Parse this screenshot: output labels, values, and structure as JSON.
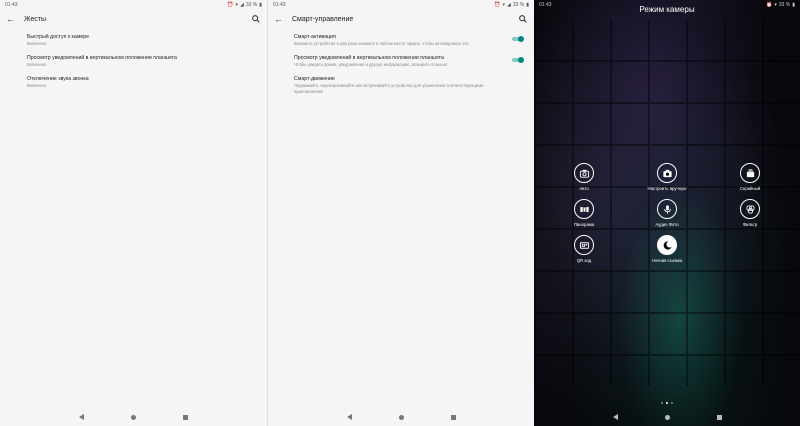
{
  "panel1": {
    "status": {
      "time": "01:43",
      "battery": "33 %"
    },
    "title": "Жесты",
    "items": [
      {
        "title": "Быстрый доступ к камере",
        "subtitle": "Включено"
      },
      {
        "title": "Просмотр уведомлений в вертикальном положении планшета",
        "subtitle": "Включено"
      },
      {
        "title": "Отключение звука звонка",
        "subtitle": "Включено"
      }
    ]
  },
  "panel2": {
    "status": {
      "time": "01:43",
      "battery": "33 %"
    },
    "title": "Смарт-управление",
    "items": [
      {
        "title": "Смарт-активация",
        "subtitle": "Возьмите устройство и два раза нажмите в любом месте экрана, чтобы активировать его",
        "toggle": true
      },
      {
        "title": "Просмотр уведомлений в вертикальном положении планшета",
        "subtitle": "Чтобы увидеть время, уведомления и другую информацию, возьмите планшет",
        "toggle": true
      },
      {
        "title": "Смарт-движение",
        "subtitle": "Поднимайте, переворачивайте или встряхивайте устройство для управления соответствующими приложениями"
      }
    ]
  },
  "panel3": {
    "status": {
      "time": "01:43",
      "battery": "33 %"
    },
    "title": "Режим камеры",
    "modes": [
      {
        "label": "Авто",
        "icon": "camera-icon"
      },
      {
        "label": "Настроить вручную",
        "icon": "manual-camera-icon"
      },
      {
        "label": "Серийный",
        "icon": "burst-icon"
      },
      {
        "label": "Панорама",
        "icon": "panorama-icon"
      },
      {
        "label": "Аудио Фото",
        "icon": "microphone-icon"
      },
      {
        "label": "Фильтр",
        "icon": "filter-icon"
      },
      {
        "label": "QR код",
        "icon": "qr-code-icon"
      },
      {
        "label": "Ночная съемка",
        "icon": "moon-icon"
      }
    ]
  },
  "colors": {
    "toggle_on": "#00897b",
    "toggle_track": "#80cbc4",
    "settings_bg": "#f5f5f5"
  }
}
